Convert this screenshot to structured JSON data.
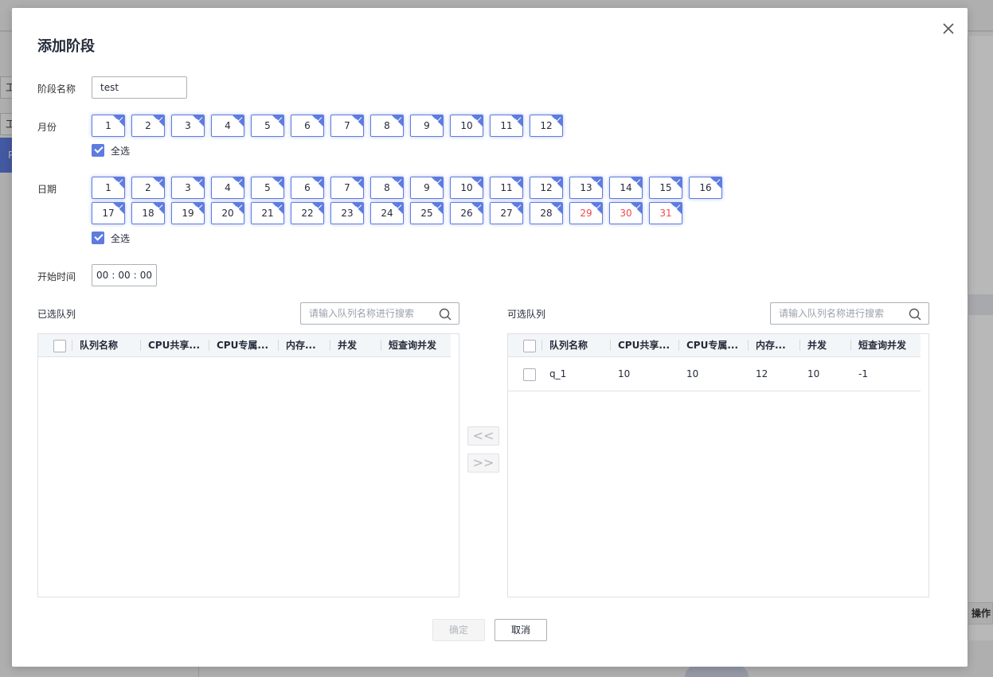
{
  "background": {
    "sidebar_items": [
      "工",
      "工"
    ],
    "sidebar_active": "P",
    "right_op_label": "操作"
  },
  "dialog": {
    "title": "添加阶段",
    "close_icon": "close-icon"
  },
  "form": {
    "name_label": "阶段名称",
    "name_value": "test",
    "month_label": "月份",
    "months": [
      "1",
      "2",
      "3",
      "4",
      "5",
      "6",
      "7",
      "8",
      "9",
      "10",
      "11",
      "12"
    ],
    "month_select_all": "全选",
    "date_label": "日期",
    "dates_row1": [
      "1",
      "2",
      "3",
      "4",
      "5",
      "6",
      "7",
      "8",
      "9",
      "10",
      "11",
      "12",
      "13",
      "14",
      "15",
      "16"
    ],
    "dates_row2": [
      "17",
      "18",
      "19",
      "20",
      "21",
      "22",
      "23",
      "24",
      "25",
      "26",
      "27",
      "28",
      "29",
      "30",
      "31"
    ],
    "red_dates": [
      "29",
      "30",
      "31"
    ],
    "date_select_all": "全选",
    "start_time_label": "开始时间",
    "start_time": {
      "h": "00",
      "m": "00",
      "s": "00",
      "sep": ":"
    }
  },
  "selected_queues": {
    "title": "已选队列",
    "search_placeholder": "请输入队列名称进行搜索",
    "columns": [
      "队列名称",
      "CPU共享...",
      "CPU专属...",
      "内存...",
      "并发",
      "短查询并发"
    ],
    "rows": []
  },
  "available_queues": {
    "title": "可选队列",
    "search_placeholder": "请输入队列名称进行搜索",
    "columns": [
      "队列名称",
      "CPU共享...",
      "CPU专属...",
      "内存...",
      "并发",
      "短查询并发"
    ],
    "rows": [
      {
        "name": "q_1",
        "cpu_shared": "10",
        "cpu_exclusive": "10",
        "memory": "12",
        "concurrency": "10",
        "short_query": "-1"
      }
    ]
  },
  "transfer": {
    "move_left": "<<",
    "move_right": ">>"
  },
  "footer": {
    "ok_label": "确定",
    "cancel_label": "取消"
  },
  "colors": {
    "accent": "#5e7ce0",
    "danger_text": "#f04a4a",
    "disabled_text": "#b3b6bd"
  }
}
